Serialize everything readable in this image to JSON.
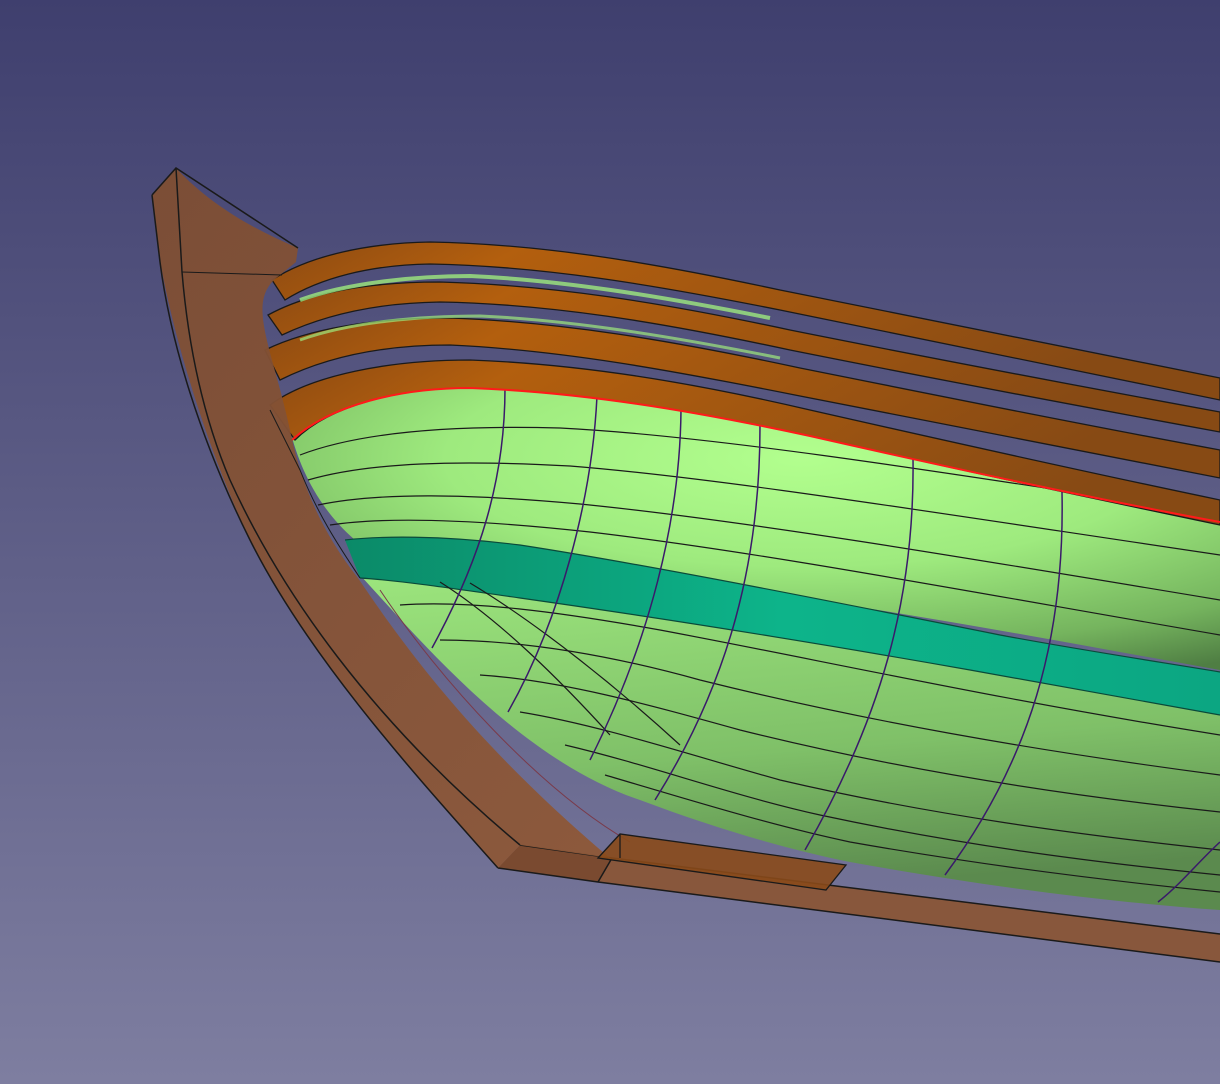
{
  "viewport": {
    "background_top": "#3F3F6E",
    "background_bottom": "#7E7EA0"
  },
  "model": {
    "hull_color": "#A6FC86",
    "hull_shadow": "#5E8F4D",
    "selected_plank_color": "#0DB48A",
    "frame_wood_color": "#8A5534",
    "strake_wood_color": "#B2600F",
    "edge_color": "#1A1A1A",
    "frame_line_color": "#3A1A6A",
    "highlight_edge_color": "#FF1A1A"
  }
}
